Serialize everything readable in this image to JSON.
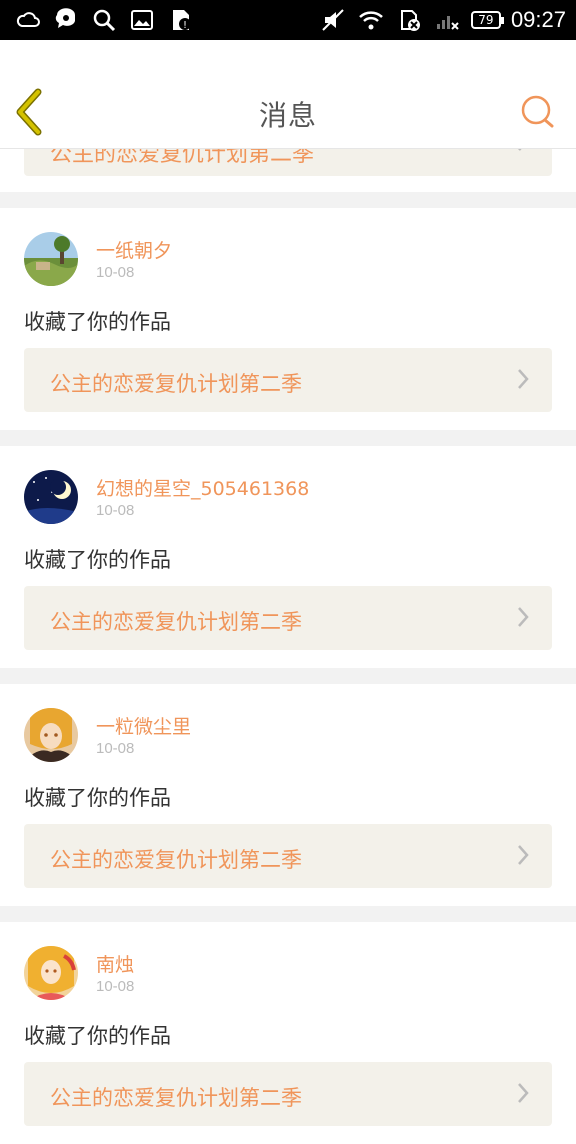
{
  "status_bar": {
    "time": "09:27",
    "battery": "79"
  },
  "header": {
    "title": "消息"
  },
  "partial_card": {
    "work_title": "公主的恋爱复仇计划第二季"
  },
  "messages": [
    {
      "username": "一纸朝夕",
      "date": "10-08",
      "action": "收藏了你的作品",
      "work_title": "公主的恋爱复仇计划第二季"
    },
    {
      "username": "幻想的星空_505461368",
      "date": "10-08",
      "action": "收藏了你的作品",
      "work_title": "公主的恋爱复仇计划第二季"
    },
    {
      "username": "一粒微尘里",
      "date": "10-08",
      "action": "收藏了你的作品",
      "work_title": "公主的恋爱复仇计划第二季"
    },
    {
      "username": "南烛",
      "date": "10-08",
      "action": "收藏了你的作品",
      "work_title": "公主的恋爱复仇计划第二季"
    }
  ],
  "colors": {
    "accent": "#f0955a",
    "back_arrow": "#c8b400",
    "card_bg": "#f3f1ea"
  }
}
